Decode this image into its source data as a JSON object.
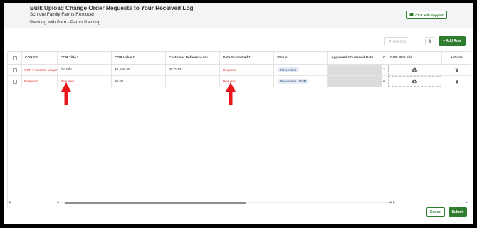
{
  "header": {
    "title": "Bulk Upload Change Order Requests to Your Received Log",
    "project": "Schrute Family Farms Remodel",
    "company": "Painting with Pam - Pam's Painting",
    "chat_label": "Chat with Support"
  },
  "toolbar": {
    "bulk_edit_label": "Bulk Edit",
    "add_row_label": "+ Add Row"
  },
  "table": {
    "columns": [
      "COR # *",
      "COR Title *",
      "COR Value *",
      "Customer Reference Nu...",
      "Date Submitted *",
      "Status",
      "Approved CO Issued Date",
      "C",
      "COR PDF File",
      "Actions"
    ],
    "rows": [
      {
        "cor_number": "COR # must be unique",
        "title": "the title",
        "value": "$5,555.55",
        "customer_ref": "PCO 33",
        "date_submitted": "Required",
        "status": "Placeholder",
        "c_col": "2"
      },
      {
        "cor_number": "Required",
        "title": "Required",
        "value": "$0.00",
        "customer_ref": "",
        "date_submitted": "Required",
        "status": "Placeholder - ROM",
        "c_col": "a"
      }
    ]
  },
  "footer": {
    "cancel_label": "Cancel",
    "submit_label": "Submit"
  },
  "colors": {
    "accent_green": "#2f7d2f",
    "error_red": "#e0281c",
    "annotation_arrow": "#e8161b"
  }
}
